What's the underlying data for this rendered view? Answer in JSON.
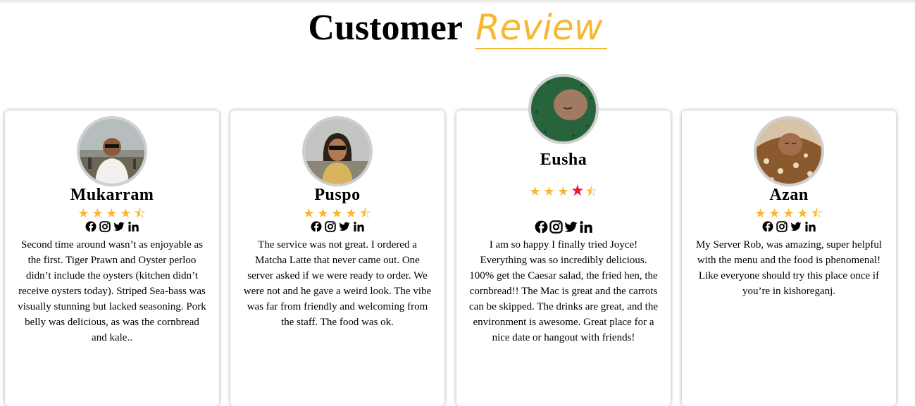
{
  "header": {
    "title_main": "Customer",
    "title_accent": "Review"
  },
  "colors": {
    "accent": "#f7b731",
    "active_star": "#e8173e"
  },
  "social_icons": [
    "facebook-icon",
    "instagram-icon",
    "twitter-icon",
    "linkedin-icon"
  ],
  "reviews": [
    {
      "name": "Mukarram",
      "rating": 4.5,
      "stars": [
        "★",
        "★",
        "★",
        "★",
        "⯪"
      ],
      "text": "Second time around wasn’t as enjoyable as the first. Tiger Prawn and Oyster perloo didn’t include the oysters (kitchen didn’t receive oysters today). Striped Sea-bass was visually stunning but lacked seasoning. Pork belly was delicious, as was the cornbread and kale.."
    },
    {
      "name": "Puspo",
      "rating": 4.5,
      "stars": [
        "★",
        "★",
        "★",
        "★",
        "⯪"
      ],
      "text": "The service was not great. I ordered a Matcha Latte that never came out. One server asked if we were ready to order. We were not and he gave a weird look. The vibe was far from friendly and welcoming from the staff. The food was ok."
    },
    {
      "name": "Eusha",
      "rating": 4.5,
      "stars": [
        "★",
        "★",
        "★",
        "★",
        "⯪"
      ],
      "text": "I am so happy I finally tried Joyce! Everything was so incredibly delicious. 100% get the Caesar salad, the fried hen, the cornbread!! The Mac is great and the carrots can be skipped. The drinks are great, and the environment is awesome. Great place for a nice date or hangout with friends!"
    },
    {
      "name": "Azan",
      "rating": 4.5,
      "stars": [
        "★",
        "★",
        "★",
        "★",
        "⯪"
      ],
      "text": "My Server Rob, was amazing, super helpful with the menu and the food is phenomenal! Like everyone should try this place once if you’re in kishoreganj."
    }
  ]
}
